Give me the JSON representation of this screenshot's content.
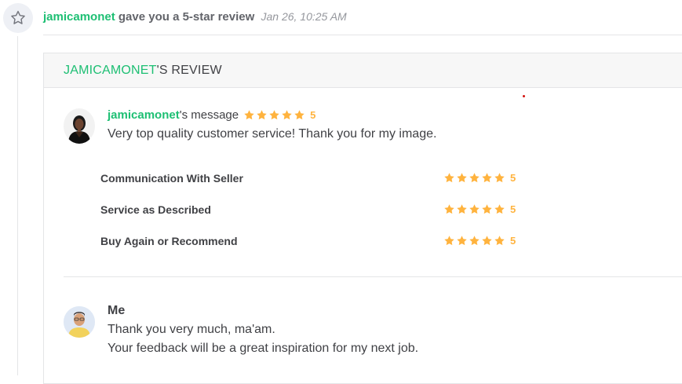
{
  "event": {
    "username": "jamicamonet",
    "text": "gave you a 5-star review",
    "time": "Jan 26, 10:25 AM"
  },
  "review": {
    "header_user": "JAMICAMONET",
    "header_suffix": "'S REVIEW",
    "message_user": "jamicamonet",
    "message_suffix": "'s message",
    "overall_rating": "5",
    "message": "Very top quality customer service! Thank you for my image.",
    "criteria": [
      {
        "label": "Communication With Seller",
        "rating": "5"
      },
      {
        "label": "Service as Described",
        "rating": "5"
      },
      {
        "label": "Buy Again or Recommend",
        "rating": "5"
      }
    ]
  },
  "reply": {
    "author": "Me",
    "lines": [
      "Thank you very much, ma'am.",
      "Your feedback will be a great inspiration for my next job."
    ]
  },
  "colors": {
    "accent": "#1dbf73",
    "star": "#ffb33e",
    "text": "#404145",
    "muted": "#95979d"
  },
  "icons": {
    "event": "star-outline-icon",
    "rating": "star-icon"
  }
}
